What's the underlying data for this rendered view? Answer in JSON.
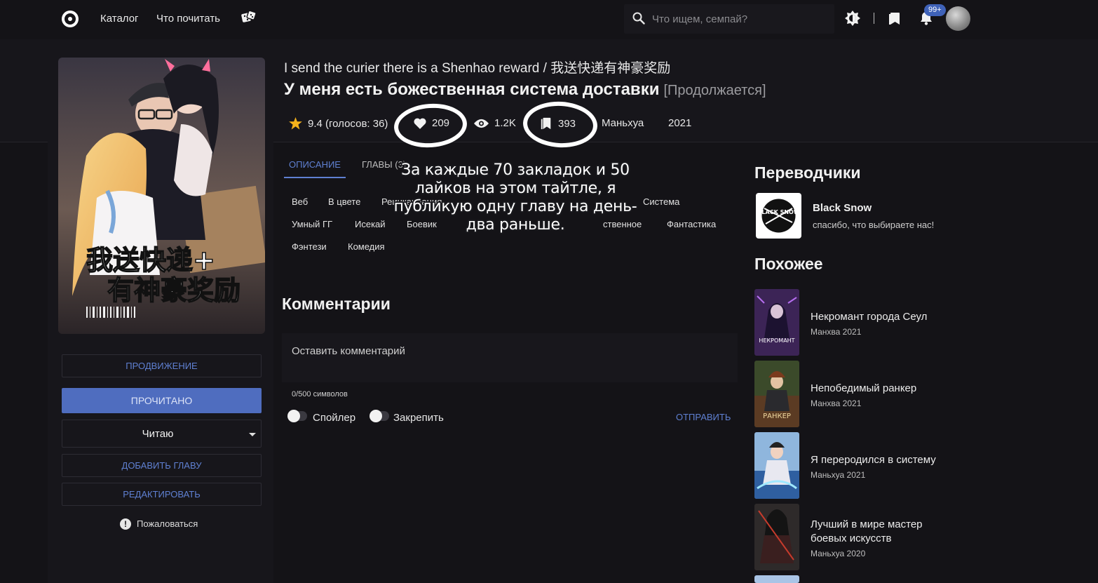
{
  "nav": {
    "catalog": "Каталог",
    "what_to_read": "Что почитать",
    "search_placeholder": "Что ищем, семпай?",
    "notifications_badge": "99+"
  },
  "manga": {
    "original_title": "I send the curier there is a Shenhao reward / 我送快递有神豪奖励",
    "title": "У меня есть божественная система доставки",
    "status": "[Продолжается]",
    "rating": "9.4 (голосов: 36)",
    "likes": "209",
    "views": "1.2K",
    "bookmarks": "393",
    "type": "Маньхуа",
    "year": "2021",
    "cover_text_line1": "我送快递+",
    "cover_text_line2": "有神豪奖励"
  },
  "sidebar": {
    "promote": "ПРОДВИЖЕНИЕ",
    "read": "ПРОЧИТАНО",
    "reading_status": "Читаю",
    "add_chapter": "ДОБАВИТЬ ГЛАВУ",
    "edit": "РЕДАКТИРОВАТЬ",
    "report": "Пожаловаться"
  },
  "tabs": {
    "description": "ОПИСАНИЕ",
    "chapters": "ГЛАВЫ (3)"
  },
  "genres": [
    "Веб",
    "В цвете",
    "Реинкарнация",
    "Система",
    "Умный ГГ",
    "Исекай",
    "Боевик",
    "ственное",
    "Фантастика",
    "Фэнтези",
    "Комедия"
  ],
  "overlay_note": "За каждые 70 закладок и 50 лайков на этом тайтле, я публикую одну главу на день-два раньше.",
  "comments": {
    "title": "Комментарии",
    "placeholder": "Оставить комментарий",
    "counter": "0/500 символов",
    "spoiler": "Спойлер",
    "pin": "Закрепить",
    "send": "ОТПРАВИТЬ"
  },
  "translators": {
    "title": "Переводчики",
    "name": "Black Snow",
    "slogan": "спасибо, что выбираете нас!",
    "logo_text": "BLACK SNOW"
  },
  "similar": {
    "title": "Похожее",
    "items": [
      {
        "title": "Некромант города Сеул",
        "meta": "Манхва 2021",
        "cover_text": "НЕКРОМАНТ"
      },
      {
        "title": "Непобедимый ранкер",
        "meta": "Манхва 2021",
        "cover_text": "РАНКЕР"
      },
      {
        "title": "Я переродился в систему",
        "meta": "Маньхуа 2021",
        "cover_text": ""
      },
      {
        "title": "Лучший в мире мастер боевых искусств",
        "meta": "Маньхуа 2020",
        "cover_text": ""
      }
    ]
  },
  "colors": {
    "accent": "#5f80d2",
    "button_fill": "#4f6dbf",
    "background": "#141317",
    "star": "#f5b21b"
  }
}
